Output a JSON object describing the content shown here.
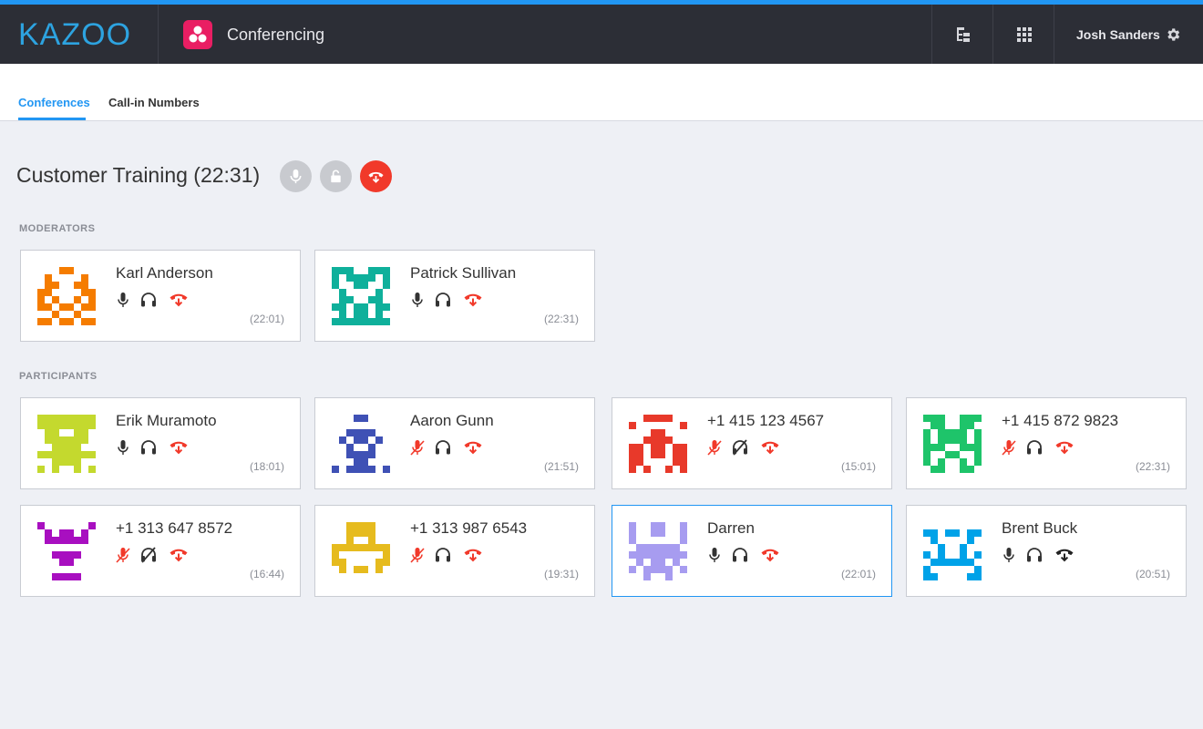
{
  "header": {
    "logo": "KAZOO",
    "app_title": "Conferencing",
    "user_name": "Josh Sanders",
    "icons": [
      "app-tree-icon",
      "apps-grid-icon",
      "settings-gear-icon"
    ],
    "app_badge_color": "#e91e63"
  },
  "tabs": [
    {
      "label": "Conferences",
      "active": true
    },
    {
      "label": "Call-in Numbers",
      "active": false
    }
  ],
  "conference": {
    "title": "Customer Training (22:31)",
    "actions": [
      "mute-all-icon",
      "lock-icon",
      "hangup-all-icon"
    ]
  },
  "moderators": {
    "label": "MODERATORS",
    "cards": [
      {
        "name": "Karl Anderson",
        "time": "(22:01)",
        "color": "#f57c00",
        "mic_muted": false,
        "deaf": false,
        "hangup_red": true,
        "selected": false
      },
      {
        "name": "Patrick Sullivan",
        "time": "(22:31)",
        "color": "#0fb09b",
        "mic_muted": false,
        "deaf": false,
        "hangup_red": true,
        "selected": false
      }
    ]
  },
  "participants": {
    "label": "PARTICIPANTS",
    "cards": [
      {
        "name": "Erik Muramoto",
        "time": "(18:01)",
        "color": "#c4d92e",
        "mic_muted": false,
        "deaf": false,
        "hangup_red": true,
        "selected": false
      },
      {
        "name": "Aaron Gunn",
        "time": "(21:51)",
        "color": "#3f51b5",
        "mic_muted": true,
        "deaf": false,
        "hangup_red": true,
        "selected": false
      },
      {
        "name": "+1 415 123 4567",
        "time": "(15:01)",
        "color": "#e8392a",
        "mic_muted": true,
        "deaf": true,
        "hangup_red": true,
        "selected": false
      },
      {
        "name": "+1 415 872 9823",
        "time": "(22:31)",
        "color": "#1ec46a",
        "mic_muted": true,
        "deaf": false,
        "hangup_red": true,
        "selected": false
      },
      {
        "name": "+1 313 647 8572",
        "time": "(16:44)",
        "color": "#a80fc0",
        "mic_muted": true,
        "deaf": true,
        "hangup_red": true,
        "selected": false
      },
      {
        "name": "+1 313 987 6543",
        "time": "(19:31)",
        "color": "#e6bb1e",
        "mic_muted": true,
        "deaf": false,
        "hangup_red": true,
        "selected": false
      },
      {
        "name": "Darren",
        "time": "(22:01)",
        "color": "#a79cf0",
        "mic_muted": false,
        "deaf": false,
        "hangup_red": true,
        "selected": true
      },
      {
        "name": "Brent Buck",
        "time": "(20:51)",
        "color": "#00a2e8",
        "mic_muted": false,
        "deaf": false,
        "hangup_red": false,
        "selected": false
      }
    ]
  }
}
